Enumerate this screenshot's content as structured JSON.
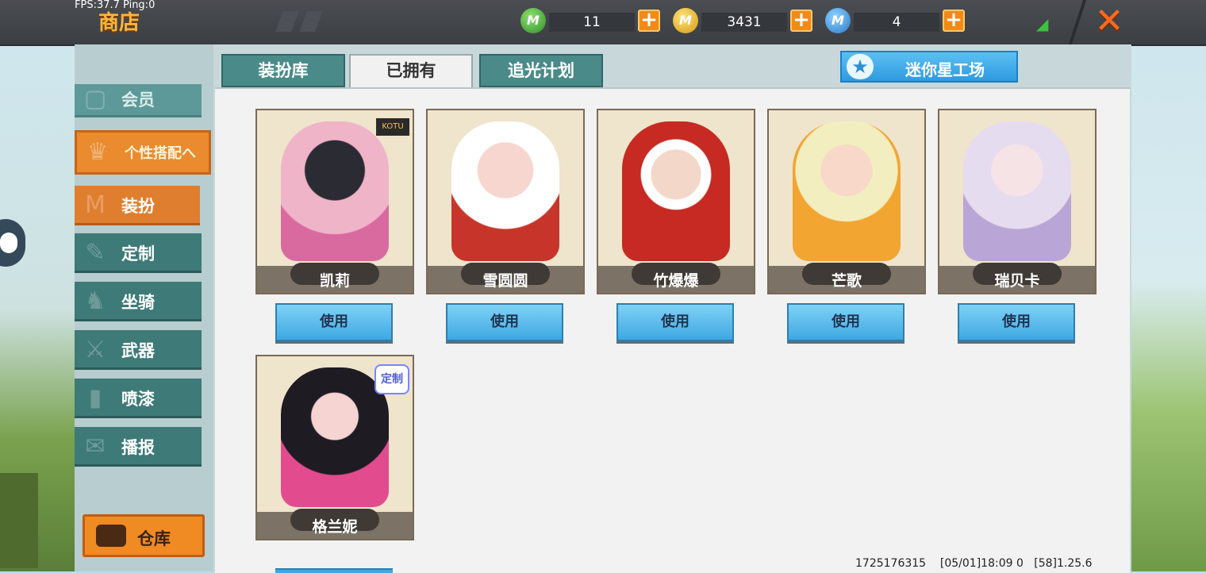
{
  "status": {
    "fps": "FPS:37.7  Ping:0"
  },
  "header": {
    "title": "商店",
    "currencies": [
      {
        "icon": "green-gem-coin-icon",
        "value": "11"
      },
      {
        "icon": "gold-coin-icon",
        "value": "3431"
      },
      {
        "icon": "blue-coin-icon",
        "value": "4"
      }
    ],
    "plus_label": "+",
    "close_label": "✕"
  },
  "sidebar": {
    "items": [
      {
        "label": "会员",
        "icon": "member-icon"
      },
      {
        "label": "个性搭配へ",
        "icon": "trophy-icon"
      },
      {
        "label": "装扮",
        "icon": "shirt-icon"
      },
      {
        "label": "定制",
        "icon": "pencil-icon"
      },
      {
        "label": "坐骑",
        "icon": "mount-icon"
      },
      {
        "label": "武器",
        "icon": "gun-icon"
      },
      {
        "label": "喷漆",
        "icon": "spray-icon"
      },
      {
        "label": "播报",
        "icon": "broadcast-icon"
      }
    ],
    "warehouse_label": "仓库"
  },
  "tabs": [
    {
      "label": "装扮库"
    },
    {
      "label": "已拥有"
    },
    {
      "label": "追光计划"
    }
  ],
  "studio_button": {
    "label": "迷你星工场",
    "icon": "star-icon"
  },
  "skins": [
    {
      "name": "凯莉",
      "button": "使用",
      "badge": "logo-badge"
    },
    {
      "name": "雪圆圆",
      "button": "使用"
    },
    {
      "name": "竹爆爆",
      "button": "使用"
    },
    {
      "name": "芒歌",
      "button": "使用"
    },
    {
      "name": "瑞贝卡",
      "button": "使用"
    },
    {
      "name": "格兰妮",
      "badge": "定制"
    }
  ],
  "footer": {
    "id": "1725176315",
    "datetime": "[05/01]18:09 0",
    "version": "[58]1.25.6"
  },
  "colors": {
    "accent_orange": "#e98b2e",
    "teal": "#3d7a78",
    "button_blue": "#3fa8e4"
  }
}
